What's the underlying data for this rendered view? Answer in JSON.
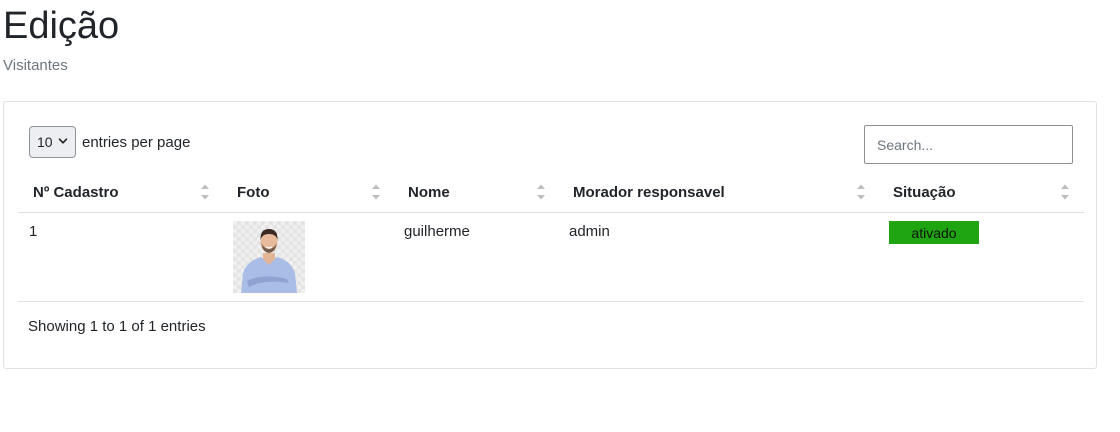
{
  "header": {
    "title": "Edição",
    "subtitle": "Visitantes"
  },
  "datatable": {
    "per_page_value": "10",
    "per_page_label": "entries per page",
    "search_placeholder": "Search...",
    "columns": [
      "Nº Cadastro",
      "Foto",
      "Nome",
      "Morador responsavel",
      "Situação"
    ],
    "rows": [
      {
        "id": "1",
        "photo": "visitor-photo",
        "name": "guilherme",
        "resident": "admin",
        "status": "ativado"
      }
    ],
    "info": "Showing 1 to 1 of 1 entries"
  },
  "colors": {
    "status_active": "#1ea511",
    "border": "#dee2e6",
    "muted_text": "#6c757d"
  },
  "icons": {
    "sort": "sort-icon",
    "chevron": "chevron-down-icon"
  }
}
